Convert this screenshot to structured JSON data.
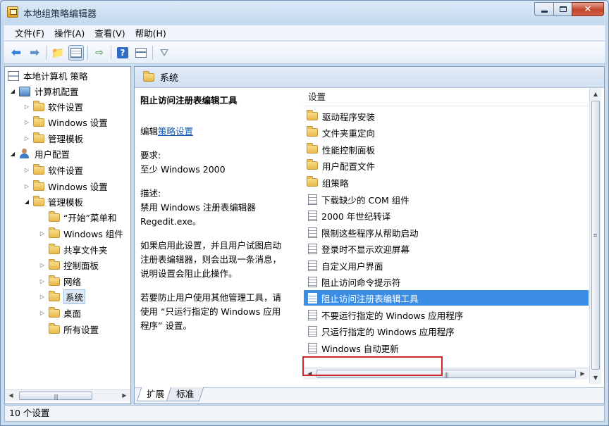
{
  "window": {
    "title": "本地组策略编辑器"
  },
  "menu": {
    "items": [
      "文件(F)",
      "操作(A)",
      "查看(V)",
      "帮助(H)"
    ]
  },
  "tree": {
    "root": "本地计算机 策略",
    "items": [
      {
        "label": "计算机配置"
      },
      {
        "label": "软件设置"
      },
      {
        "label": "Windows 设置"
      },
      {
        "label": "管理模板"
      },
      {
        "label": "用户配置"
      },
      {
        "label": "软件设置"
      },
      {
        "label": "Windows 设置"
      },
      {
        "label": "管理模板"
      },
      {
        "label": "“开始”菜单和"
      },
      {
        "label": "Windows 组件"
      },
      {
        "label": "共享文件夹"
      },
      {
        "label": "控制面板"
      },
      {
        "label": "网络"
      },
      {
        "label": "系统"
      },
      {
        "label": "桌面"
      },
      {
        "label": "所有设置"
      }
    ]
  },
  "panel": {
    "header": "系统"
  },
  "description": {
    "title": "阻止访问注册表编辑工具",
    "edit_prefix": "编辑",
    "edit_link": "策略设置",
    "req_label": "要求:",
    "req_value": "至少 Windows 2000",
    "desc_label": "描述:",
    "desc_line1": "禁用 Windows 注册表编辑器",
    "desc_line2": "Regedit.exe。",
    "para1_l1": "如果启用此设置，并且用户试图启动",
    "para1_l2": "注册表编辑器，则会出现一条消息，",
    "para1_l3": "说明设置会阻止此操作。",
    "para2_l1": "若要防止用户使用其他管理工具，请",
    "para2_l2": "使用 “只运行指定的 Windows 应用",
    "para2_l3": "程序” 设置。"
  },
  "list": {
    "header": "设置",
    "folders": [
      "驱动程序安装",
      "文件夹重定向",
      "性能控制面板",
      "用户配置文件",
      "组策略"
    ],
    "settings": [
      "下载缺少的 COM 组件",
      "2000 年世纪转译",
      "限制这些程序从帮助启动",
      "登录时不显示欢迎屏幕",
      "自定义用户界面",
      "阻止访问命令提示符",
      "阻止访问注册表编辑工具",
      "不要运行指定的 Windows 应用程序",
      "只运行指定的 Windows 应用程序",
      "Windows 自动更新"
    ],
    "selected": "阻止访问注册表编辑工具"
  },
  "tabs": [
    "扩展",
    "标准"
  ],
  "status": {
    "text": "10 个设置"
  },
  "colors": {
    "selection": "#3b8de3",
    "highlight_box": "#d22a2a",
    "link": "#0d5ab5"
  }
}
